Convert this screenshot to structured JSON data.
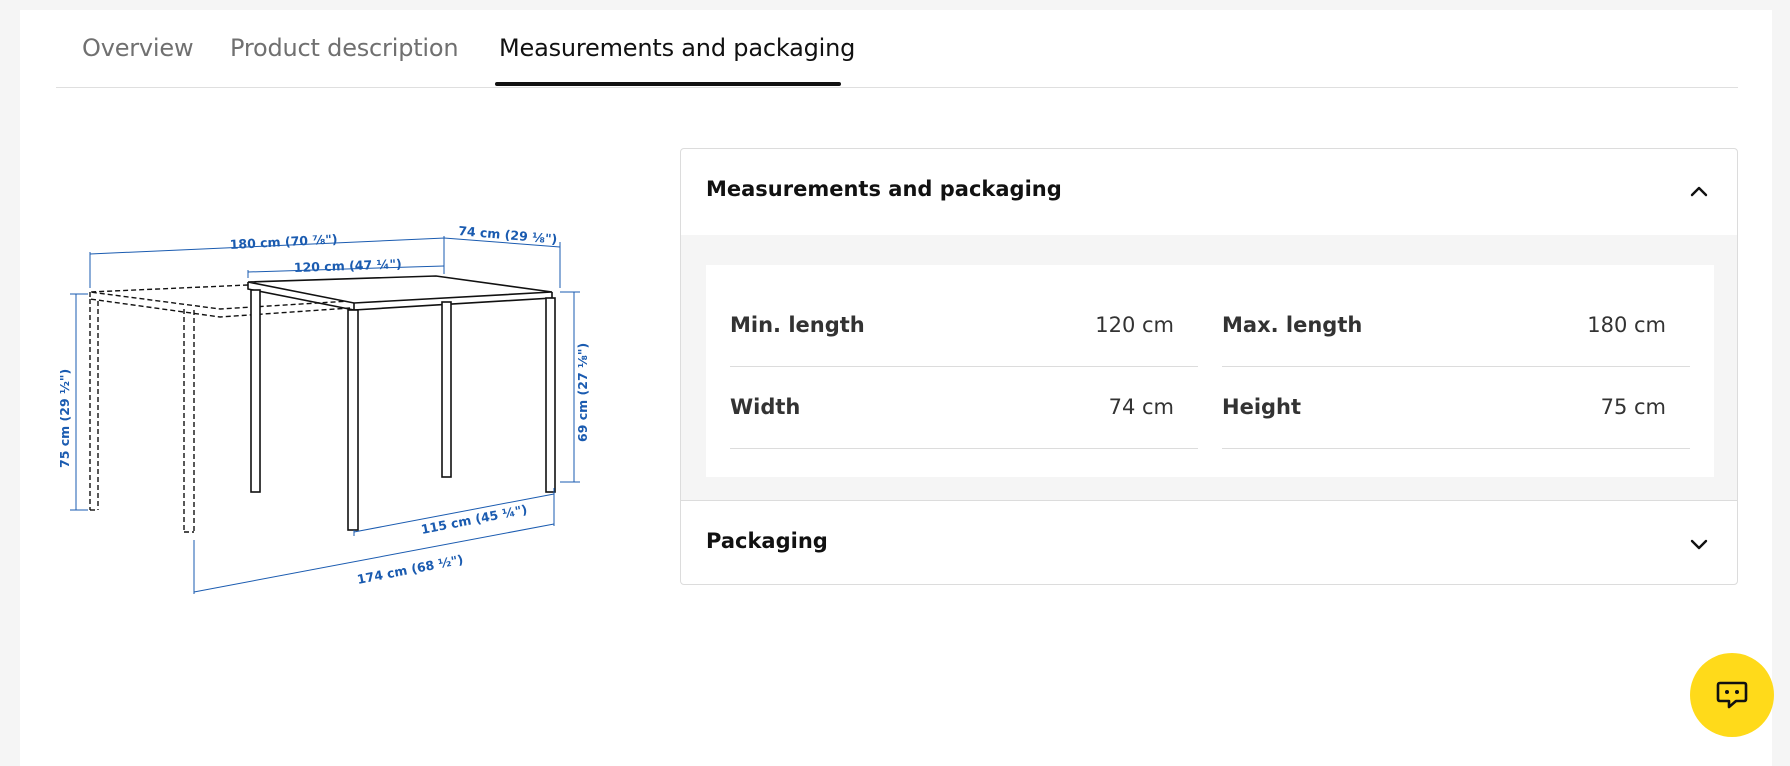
{
  "tabs": {
    "overview": "Overview",
    "description": "Product description",
    "measurements": "Measurements and packaging"
  },
  "drawing": {
    "max_length": "180 cm (70 ⅞\")",
    "min_length": "120 cm (47 ¼\")",
    "width": "74 cm (29 ⅛\")",
    "height": "75 cm (29 ½\")",
    "underframe_height": "69 cm (27 ⅛\")",
    "leg_span_short": "115 cm (45 ¼\")",
    "leg_span_long": "174 cm (68 ½\")"
  },
  "accordion": {
    "measurements_title": "Measurements and packaging",
    "packaging_title": "Packaging",
    "specs": [
      {
        "label": "Min. length",
        "value": "120 cm"
      },
      {
        "label": "Max. length",
        "value": "180 cm"
      },
      {
        "label": "Width",
        "value": "74 cm"
      },
      {
        "label": "Height",
        "value": "75 cm"
      }
    ]
  },
  "icons": {
    "collapse": "chevron-up-icon",
    "expand": "chevron-down-icon",
    "chat": "chat-icon"
  },
  "colors": {
    "dimension_blue": "#1a5bb0",
    "chat_yellow": "#ffda1a"
  }
}
